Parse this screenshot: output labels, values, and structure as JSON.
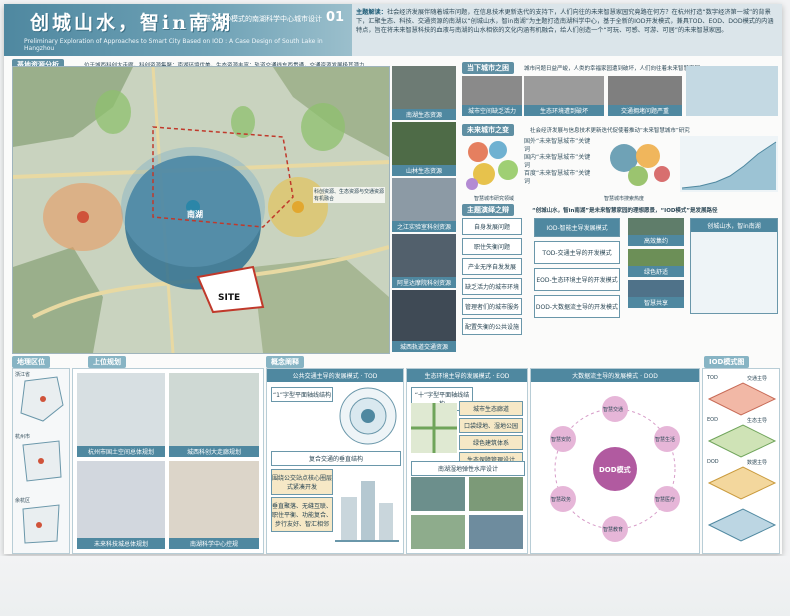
{
  "header": {
    "brand": "创城山水，智in南湖",
    "subtitle": "——基于IOD模式的南湖科学中心城市设计",
    "sheet_no": "01",
    "english_title": "Preliminary Exploration of Approaches to Smart City Based on IOD : A Case Design of South Lake in Hangzhou",
    "intro_label": "主题解读：",
    "intro_text": "社会经济发展伴随着城市问题，在信息技术更新迭代的支持下，人们向往的未来智慧家园究竟路在何方？在杭州打造“数字经济第一城”的背景下，汇聚生态、科技、交通资源的南湖以“创城山水，智in南湖”为主题打造南湖科学中心，基于全新的IOD开发模式，兼具TOD、EOD、DOD模式的内涵特点，旨在将未来智慧科技的血液与南湖的山水相依的文化内涵有机融合，给人们创造一个“可玩、可感、可游、可居”的未来智慧家园。"
  },
  "sections": {
    "base": "基地资源分析",
    "base_desc": "位于城西科创大走廊，科创资源集聚；南湖环境优美，生态资源丰富；轨道交通线东西贯通，交通资源发展极其潜力",
    "current": "当下城市之困",
    "future": "未来城市之变",
    "theme": "主题演绎之辩",
    "location": "地理区位",
    "upper": "上位规划",
    "concept": "概念阐释",
    "iod": "IOD模式图"
  },
  "map": {
    "site": "SITE",
    "lake": "南湖",
    "note": "科创资源、生态资源与交通资源有机融合"
  },
  "photos": [
    {
      "label": "南湖生态资源"
    },
    {
      "label": "山林生态资源"
    },
    {
      "label": "之江实验室科创资源"
    },
    {
      "label": "阿里达摩院科创资源"
    },
    {
      "label": "城西轨道交通资源"
    }
  ],
  "current": {
    "text": "城市问题日益严峻，人类的幸福家园遭到破坏，人们向往着未来智慧家园",
    "cards": [
      "城市空间缺乏活力",
      "生态环境遭到破坏",
      "交通拥堵问题严重"
    ]
  },
  "future": {
    "text": "社会经济发展与信息技术更新迭代促使着推动“未来智慧城市”研究",
    "items": [
      "国外“未来智慧城市”关键词",
      "国内“未来智慧城市”关键词",
      "百度“未来智慧城市”关键词"
    ],
    "chart_caption": "智慧城市搜索热度",
    "word_caption": "智慧城市研究领域"
  },
  "theme": {
    "heading": "“创城山水，智in南湖”是未来智慧家园的理想愿景，“IOD模式”是发展路径",
    "left": [
      "自身发展问题",
      "职住失衡问题",
      "产业无序自发发展",
      "缺乏活力的城市环境",
      "管理者们的城市服务",
      "配置失衡的公共设施"
    ],
    "mid_title": "IOD-智能主导发展模式",
    "mid": [
      "TOD-交通主导的开发模式",
      "EOD-生态环境主导的开发模式",
      "DOD-大数据流主导的开发模式"
    ],
    "right": [
      "高效集约",
      "绿色舒适",
      "智慧共享"
    ],
    "vision": "创城山水，智in南湖"
  },
  "concept": {
    "tod": "公共交通主导的发展模式 · TOD",
    "eod": "生态环境主导的发展模式 · EOD",
    "dod": "大数据流主导的发展模式 · DOD",
    "tod_points": [
      "“1”字型平面轴线结构",
      "复合交通的垂直结构",
      "围绕公交站点核心圈层式紧凑开发",
      "垂直聚落、无缝互联、职住平衡、功能复合、步行友好、智汇相邻"
    ],
    "eod_points": [
      "“十”字型平面轴线结构",
      "城市生态廊道",
      "口袋绿地、湿地公园",
      "绿色建筑体系",
      "生态保障管理设计",
      "南湖湿地弹性水岸设计"
    ],
    "dod_center": "DOD模式",
    "dod_nodes": [
      "智慧交通",
      "智慧生活",
      "智慧医疗",
      "智慧教育",
      "智慧政务",
      "智慧安防"
    ]
  },
  "location": {
    "labels": [
      "浙江省",
      "杭州市",
      "余杭区"
    ]
  },
  "upper": {
    "maps": [
      "杭州市国土空间总体规划",
      "城西科创大走廊规划",
      "未来科技城总体规划",
      "南湖科学中心控规"
    ]
  },
  "iod": {
    "labels": [
      "TOD",
      "EOD",
      "DOD",
      "交通主导",
      "生态主导",
      "数据主导"
    ]
  }
}
